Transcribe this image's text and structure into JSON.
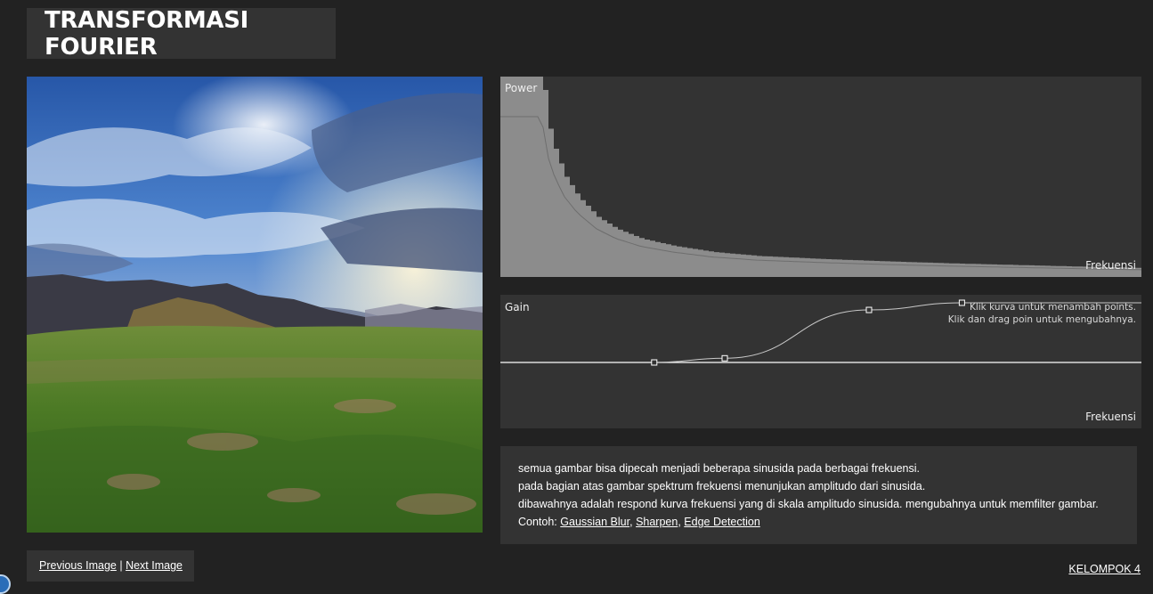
{
  "page": {
    "title": "TRANSFORMASI FOURIER"
  },
  "power_panel": {
    "y_label": "Power",
    "x_label": "Frekuensi"
  },
  "gain_panel": {
    "y_label": "Gain",
    "x_label": "Frekuensi",
    "hint_line1": "Klik kurva untuk menambah points.",
    "hint_line2": "Klik dan drag poin untuk mengubahnya."
  },
  "description": {
    "line1": "semua gambar bisa dipecah menjadi beberapa sinusida pada berbagai frekuensi.",
    "line2": "pada bagian atas gambar spektrum frekuensi menunjukan amplitudo dari sinusida.",
    "line3": "dibawahnya adalah respond kurva frekuensi yang di skala amplitudo sinusida. mengubahnya untuk memfilter gambar.",
    "example_prefix": "Contoh:",
    "examples": [
      "Gaussian Blur",
      "Sharpen",
      "Edge Detection"
    ],
    "separator": ","
  },
  "nav": {
    "previous_label": "Previous Image",
    "divider": "|",
    "next_label": "Next Image"
  },
  "footer": {
    "credit_label": "KELOMPOK 4"
  },
  "colors": {
    "background": "#222222",
    "panel": "#333333",
    "spectrum_fill": "#8c8c8c",
    "curve": "#cfcfcf"
  },
  "chart_data": [
    {
      "type": "area",
      "ylabel": "Power",
      "xlabel": "Frekuensi",
      "x_range": [
        0,
        1
      ],
      "y_range": [
        0,
        1
      ],
      "series": [
        {
          "x": [
            0,
            0.065,
            0.07,
            0.085,
            0.1,
            0.12,
            0.15,
            0.18,
            0.22,
            0.27,
            0.33,
            0.4,
            0.5,
            0.6,
            0.7,
            0.8,
            0.9,
            1.0
          ],
          "values": [
            1.0,
            1.0,
            0.8,
            0.62,
            0.5,
            0.4,
            0.3,
            0.24,
            0.19,
            0.155,
            0.125,
            0.105,
            0.09,
            0.078,
            0.068,
            0.06,
            0.052,
            0.045
          ]
        }
      ]
    },
    {
      "type": "line",
      "ylabel": "Gain",
      "xlabel": "Frekuensi",
      "x_range": [
        0,
        1
      ],
      "y_range": [
        0,
        1
      ],
      "control_points": [
        {
          "x": 0.24,
          "y": 0.0
        },
        {
          "x": 0.35,
          "y": 0.07
        },
        {
          "x": 0.575,
          "y": 0.88
        },
        {
          "x": 0.72,
          "y": 1.0
        }
      ],
      "baseline": 0.0
    }
  ]
}
